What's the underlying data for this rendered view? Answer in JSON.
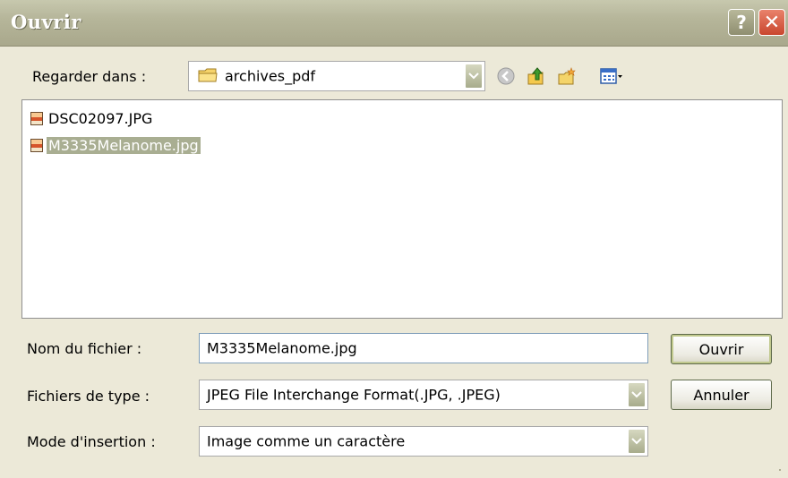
{
  "window": {
    "title": "Ouvrir",
    "help_label": "?",
    "close_label": "✕"
  },
  "lookin": {
    "label": "Regarder dans :",
    "value": "archives_pdf"
  },
  "files": [
    {
      "name": "DSC02097.JPG",
      "selected": false
    },
    {
      "name": "M3335Melanome.jpg",
      "selected": true
    }
  ],
  "filename": {
    "label": "Nom du fichier :",
    "value": "M3335Melanome.jpg"
  },
  "filetype": {
    "label": "Fichiers de type :",
    "value": "JPEG File Interchange Format(.JPG, .JPEG)"
  },
  "insertmode": {
    "label": "Mode d'insertion :",
    "value": "Image comme un caractère"
  },
  "buttons": {
    "open": "Ouvrir",
    "cancel": "Annuler"
  },
  "icons": {
    "back": "back-arrow-icon",
    "up": "up-folder-icon",
    "new_folder": "new-folder-icon",
    "views": "views-menu-icon"
  },
  "colors": {
    "titlebar": "#B6B69A",
    "selection": "#A9AE92",
    "close": "#C9462E"
  }
}
